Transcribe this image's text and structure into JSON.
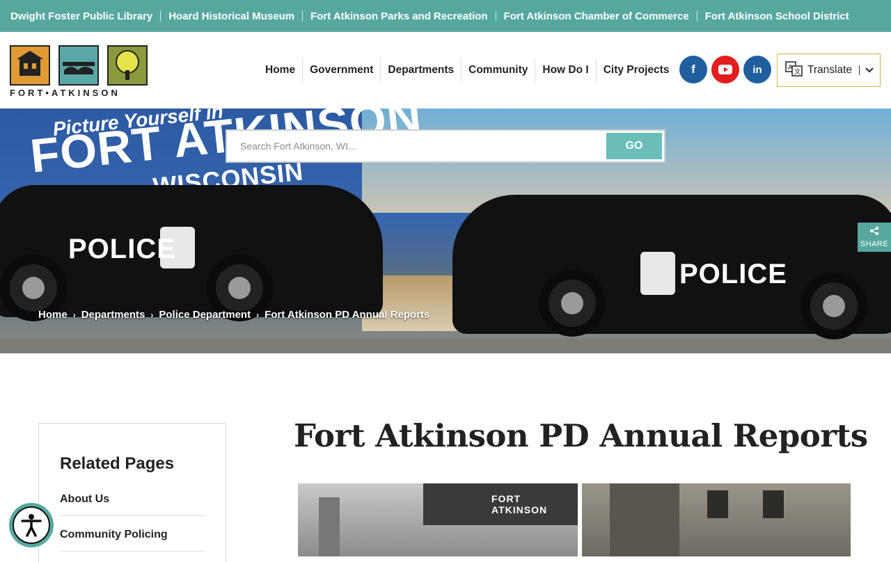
{
  "top_links": [
    "Dwight Foster Public Library",
    "Hoard Historical Museum",
    "Fort Atkinson Parks and Recreation",
    "Fort Atkinson Chamber of Commerce",
    "Fort Atkinson School District"
  ],
  "logo": {
    "text": "FORT•ATKINSON"
  },
  "nav": [
    "Home",
    "Government",
    "Departments",
    "Community",
    "How Do I",
    "City Projects"
  ],
  "social": {
    "facebook": "f",
    "youtube": "▶",
    "linkedin": "in"
  },
  "translate": {
    "label": "Translate",
    "icon": "translate-icon"
  },
  "hero": {
    "line1": "Picture Yourself in",
    "line2": "FORT ATKINSON",
    "line3": "WISCONSIN",
    "car_text": "POLICE",
    "car_subtext": "FORT ATKINSON"
  },
  "search": {
    "placeholder": "Search Fort Atkinson, WI...",
    "button": "GO"
  },
  "share": {
    "label": "SHARE"
  },
  "breadcrumb": [
    "Home",
    "Departments",
    "Police Department",
    "Fort Atkinson PD Annual Reports"
  ],
  "sidebar": {
    "title": "Related Pages",
    "links": [
      "About Us",
      "Community Policing"
    ]
  },
  "page": {
    "title": "Fort Atkinson PD Annual Reports"
  },
  "photo": {
    "sign_text": "FORT ATKINSON"
  },
  "colors": {
    "accent": "#56a89f",
    "search_button": "#6bbdb8",
    "facebook": "#1f5f9e",
    "youtube": "#e11d1d"
  }
}
